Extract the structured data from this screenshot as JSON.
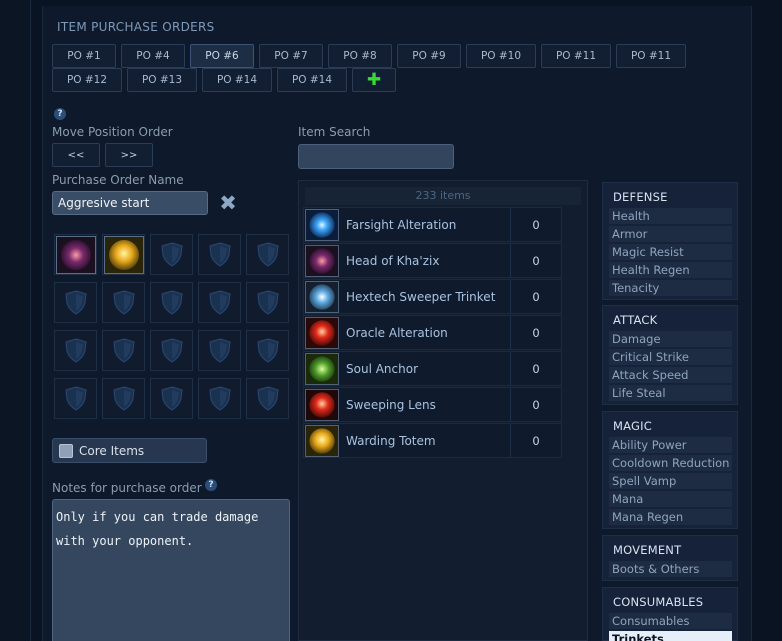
{
  "title": "ITEM PURCHASE ORDERS",
  "po_tabs": [
    "PO #1",
    "PO #4",
    "PO #6",
    "PO #7",
    "PO #8",
    "PO #9",
    "PO #10",
    "PO #11",
    "PO #11",
    "PO #12",
    "PO #13",
    "PO #14",
    "PO #14"
  ],
  "po_active": "PO #6",
  "help_glyph": "?",
  "move": {
    "label": "Move Position Order",
    "left": "<<",
    "right": ">>"
  },
  "name": {
    "label": "Purchase Order Name",
    "value": "Aggresive start"
  },
  "core_items": "Core Items",
  "notes": {
    "label": "Notes for purchase order",
    "value": "Only if you can trade damage\nwith your opponent."
  },
  "search": {
    "label": "Item Search",
    "value": ""
  },
  "results_count": "233 items",
  "items": [
    {
      "name": "Farsight Alteration",
      "qty": "0",
      "icon": "farsight-icon"
    },
    {
      "name": "Head of Kha'zix",
      "qty": "0",
      "icon": "khazix-head-icon"
    },
    {
      "name": "Hextech Sweeper Trinket",
      "qty": "0",
      "icon": "sweeper-icon"
    },
    {
      "name": "Oracle Alteration",
      "qty": "0",
      "icon": "oracle-icon"
    },
    {
      "name": "Soul Anchor",
      "qty": "0",
      "icon": "soul-anchor-icon"
    },
    {
      "name": "Sweeping Lens",
      "qty": "0",
      "icon": "sweeping-lens-icon"
    },
    {
      "name": "Warding Totem",
      "qty": "0",
      "icon": "warding-totem-icon"
    }
  ],
  "categories": [
    {
      "name": "DEFENSE",
      "items": [
        "Health",
        "Armor",
        "Magic Resist",
        "Health Regen",
        "Tenacity"
      ]
    },
    {
      "name": "ATTACK",
      "items": [
        "Damage",
        "Critical Strike",
        "Attack Speed",
        "Life Steal"
      ]
    },
    {
      "name": "MAGIC",
      "items": [
        "Ability Power",
        "Cooldown Reduction",
        "Spell Vamp",
        "Mana",
        "Mana Regen"
      ]
    },
    {
      "name": "MOVEMENT",
      "items": [
        "Boots & Others"
      ]
    },
    {
      "name": "CONSUMABLES",
      "items": [
        "Consumables",
        "Trinkets"
      ]
    }
  ],
  "selected_category": "Trinkets",
  "colors": {
    "accent": "#38d838",
    "text": "#a9c2e0",
    "panel": "#0e1a2b"
  }
}
